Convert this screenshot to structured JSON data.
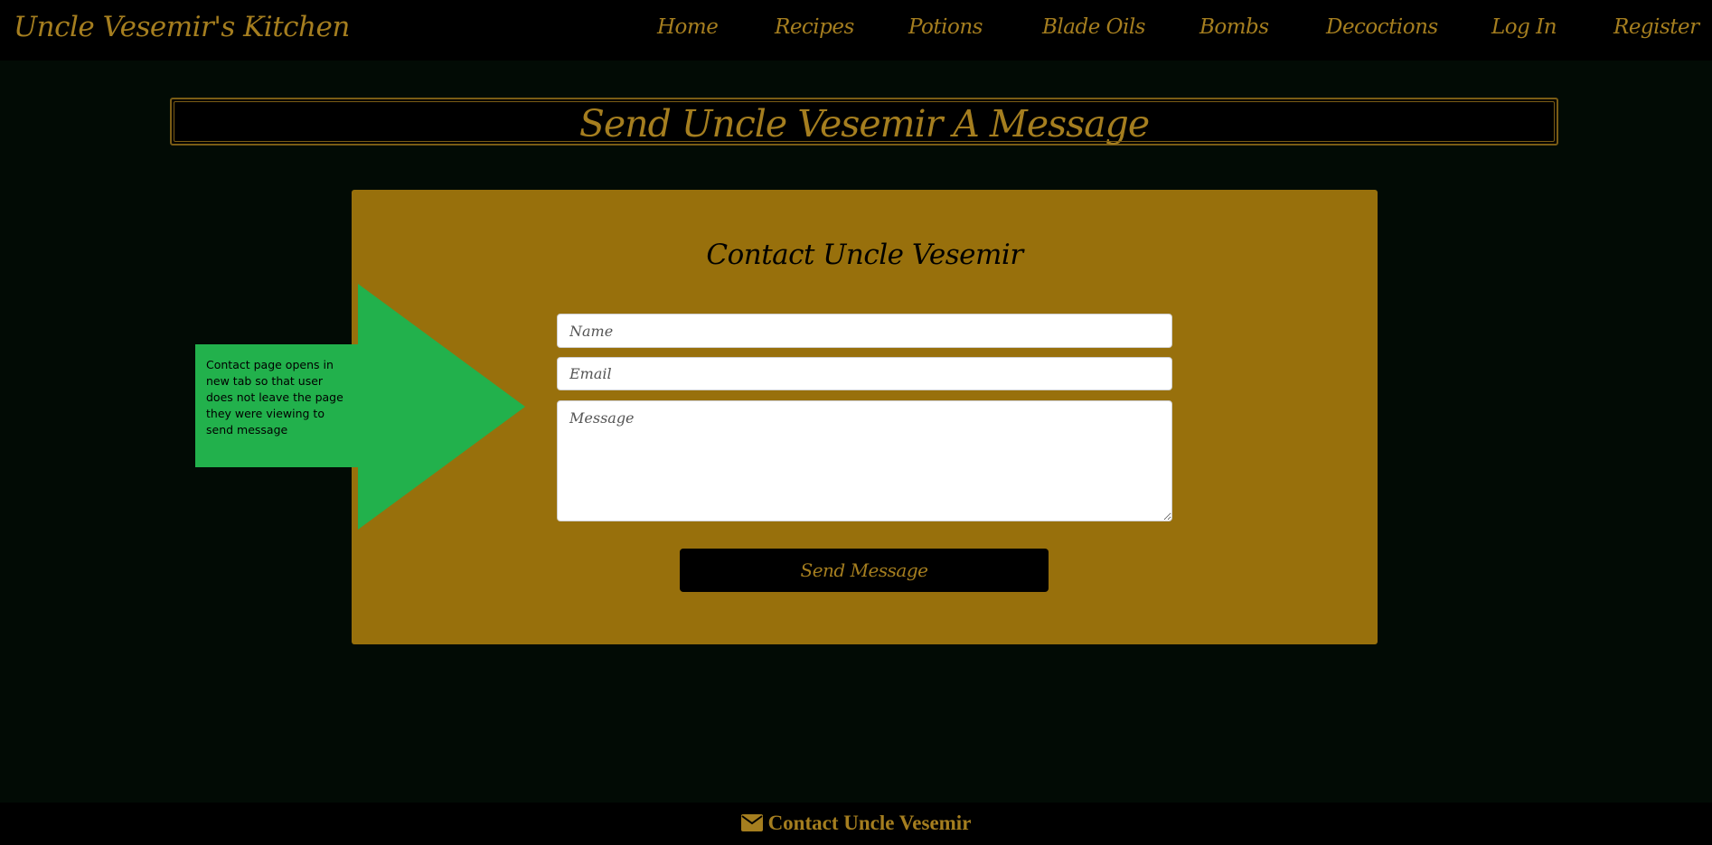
{
  "site": {
    "brand": "Uncle Vesemir's Kitchen"
  },
  "nav": {
    "items": [
      {
        "label": "Home"
      },
      {
        "label": "Recipes"
      },
      {
        "label": "Potions"
      },
      {
        "label": "Blade Oils"
      },
      {
        "label": "Bombs"
      },
      {
        "label": "Decoctions"
      },
      {
        "label": "Log In"
      },
      {
        "label": "Register"
      }
    ]
  },
  "hero": {
    "title": "Send Uncle Vesemir A Message"
  },
  "contact_form": {
    "title": "Contact Uncle Vesemir",
    "name_placeholder": "Name",
    "email_placeholder": "Email",
    "message_placeholder": "Message",
    "submit_label": "Send Message"
  },
  "annotation": {
    "text": "Contact page opens in new tab so that user does not leave the page they were viewing to send message",
    "color": "#22b14c"
  },
  "footer": {
    "link_label": "Contact Uncle Vesemir",
    "icon": "envelope-icon"
  },
  "colors": {
    "accent": "#a57e1f",
    "card": "#98700c",
    "background": "#020b05",
    "bar": "#000000"
  }
}
